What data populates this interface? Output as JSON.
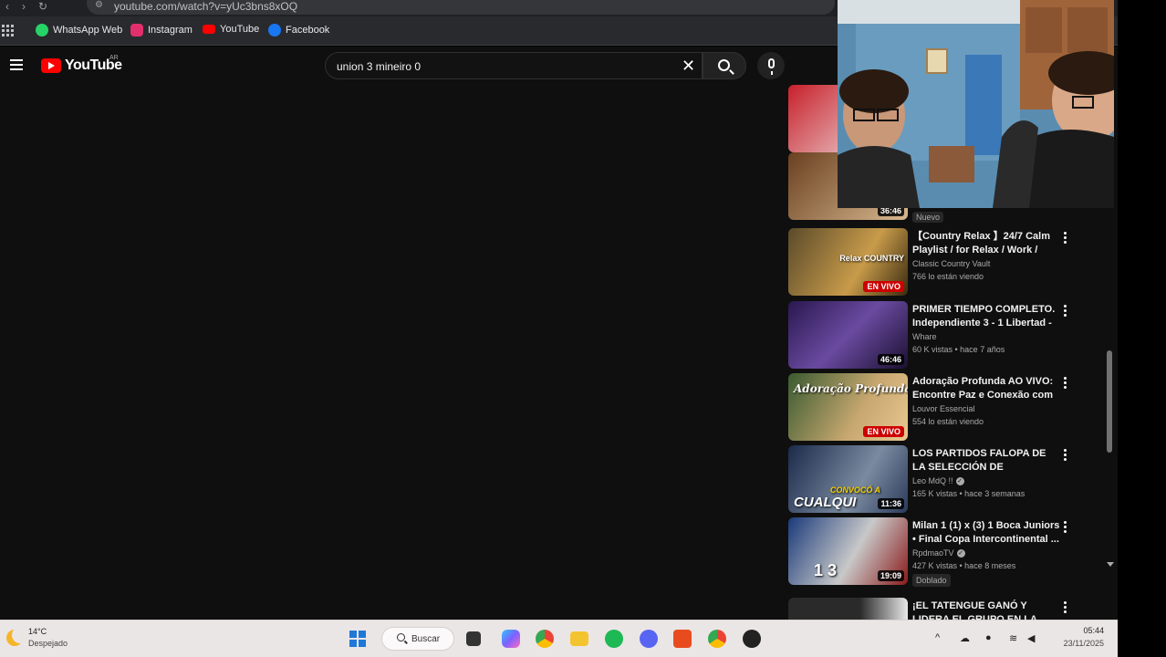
{
  "browser": {
    "url": "youtube.com/watch?v=yUc3bns8xOQ",
    "bookmarks": [
      {
        "label": "WhatsApp Web",
        "icon": "whatsapp-icon",
        "color": "#25d366"
      },
      {
        "label": "Instagram",
        "icon": "instagram-icon",
        "color": "#e1306c"
      },
      {
        "label": "YouTube",
        "icon": "youtube-icon",
        "color": "#ff0000"
      },
      {
        "label": "Facebook",
        "icon": "facebook-icon",
        "color": "#1877f2"
      }
    ]
  },
  "youtube": {
    "logo_text": "YouTube",
    "country_code": "AR",
    "search_query": "union 3 mineiro 0",
    "new_badge": "Nuevo",
    "recommendations": [
      {
        "title": "【Country Relax 】24/7 Calm Playlist / for Relax / Work / Po...",
        "channel": "Classic Country Vault",
        "stats": "766 lo están viendo",
        "live": "EN VIVO",
        "overlay": "Relax COUNTRY",
        "thumb_colors": [
          "#5a4a2a",
          "#c89b4a"
        ]
      },
      {
        "title": "PRIMER TIEMPO COMPLETO. Independiente 3 - 1 Libertad - ...",
        "channel": "Whare",
        "stats": "60 K vistas • hace 7 años",
        "duration": "46:46",
        "overlay": "",
        "thumb_colors": [
          "#2a1850",
          "#6a4aa0"
        ]
      },
      {
        "title": "Adoração Profunda AO VIVO: Encontre Paz e Conexão com ...",
        "channel": "Louvor Essencial",
        "stats": "554 lo están viendo",
        "live": "EN VIVO",
        "overlay": "Adoração Profunda",
        "thumb_colors": [
          "#3a5a30",
          "#c8a870"
        ]
      },
      {
        "title": "LOS PARTIDOS FALOPA DE LA SELECCIÓN DE MARADONA ...",
        "channel": "Leo MdQ !!",
        "verified": true,
        "stats": "165 K vistas • hace 3 semanas",
        "duration": "11:36",
        "overlay": "CUALQUI",
        "overlay2": "CONVOCÓ A",
        "thumb_colors": [
          "#1a2a4a",
          "#7a8aa0"
        ]
      },
      {
        "title": "Milan 1 (1) x (3) 1 Boca Juniors • Final Copa Intercontinental ...",
        "channel": "RpdmaoTV",
        "verified": true,
        "stats": "427 K vistas • hace 8 meses",
        "duration": "19:09",
        "overlay": "1 3",
        "badge": "Doblado",
        "thumb_colors": [
          "#1a3a7a",
          "#c8c8c8"
        ]
      },
      {
        "title": "¡EL TATENGUE GANÓ Y LIDERA EL GRUPO EN LA ...",
        "channel": "",
        "stats": "",
        "overlay": "",
        "thumb_colors": [
          "#2a2a2a",
          "#e8e8e8"
        ]
      }
    ],
    "partial_top": {
      "duration": "36:46"
    }
  },
  "taskbar": {
    "weather_temp": "14°C",
    "weather_cond": "Despejado",
    "search_label": "Buscar",
    "time": "05:44",
    "date": "23/11/2025",
    "apps": [
      {
        "name": "task-view-icon",
        "color": "#333333"
      },
      {
        "name": "copilot-icon",
        "color": "#7b61ff"
      },
      {
        "name": "chrome-icon",
        "color": "#4285f4"
      },
      {
        "name": "file-explorer-icon",
        "color": "#f4c430"
      },
      {
        "name": "spotify-icon",
        "color": "#1db954"
      },
      {
        "name": "discord-icon",
        "color": "#5865f2"
      },
      {
        "name": "dts-icon",
        "color": "#e84c1e"
      },
      {
        "name": "chrome-profile-icon",
        "color": "#34a853"
      },
      {
        "name": "obs-icon",
        "color": "#222222"
      }
    ]
  }
}
